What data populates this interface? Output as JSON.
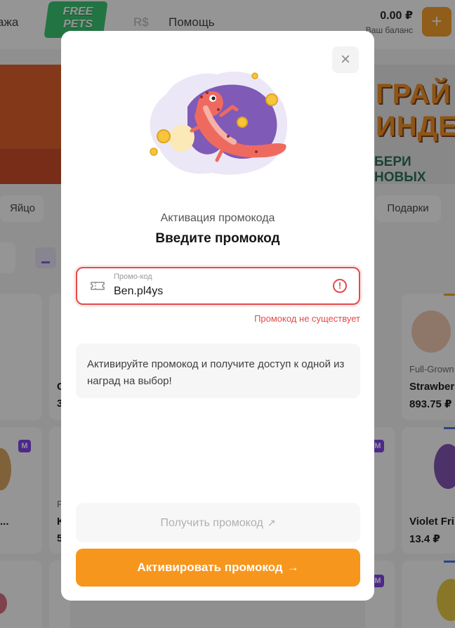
{
  "header": {
    "nav_prev": "ажа",
    "logo_line1": "FREE",
    "logo_line2": "PETS",
    "nav_currency": "R$",
    "nav_help": "Помощь",
    "balance_amount": "0.00 ₽",
    "balance_label": "Ваш баланс",
    "add_label": "+"
  },
  "banner": {
    "line1": "ГРАЙ",
    "line2": "ИНДЕ",
    "line3": "БЕРИ НОВЫХ"
  },
  "filters": {
    "egg": "Яйцо",
    "gifts": "Подарки"
  },
  "cards": [
    {
      "tag": "Full-Grown",
      "name": "Strawber",
      "price": "893.75 ₽"
    },
    {
      "tag": "",
      "name": "Violet Fri",
      "price": "13.4 ₽"
    },
    {
      "tag": "F",
      "name": "K",
      "price": "5"
    },
    {
      "tag": "",
      "name": "C",
      "price": "3"
    },
    {
      "tag": "",
      "name": "...",
      "price": ""
    }
  ],
  "badge_letter": "M",
  "modal": {
    "close_label": "×",
    "subtitle": "Активация промокода",
    "title": "Введите промокод",
    "field_label": "Промо-код",
    "field_value": "Ben.pl4ys",
    "field_error_icon": "!",
    "error_message": "Промокод не существует",
    "info_text": "Активируйте промокод и получите доступ к одной из наград на выбор!",
    "get_promo_label": "Получить промокод",
    "get_promo_icon": "↗",
    "activate_label": "Активировать промокод",
    "activate_icon": "→"
  },
  "colors": {
    "accent": "#f7961d",
    "error": "#e24b4b",
    "badge": "#7c3aed"
  }
}
